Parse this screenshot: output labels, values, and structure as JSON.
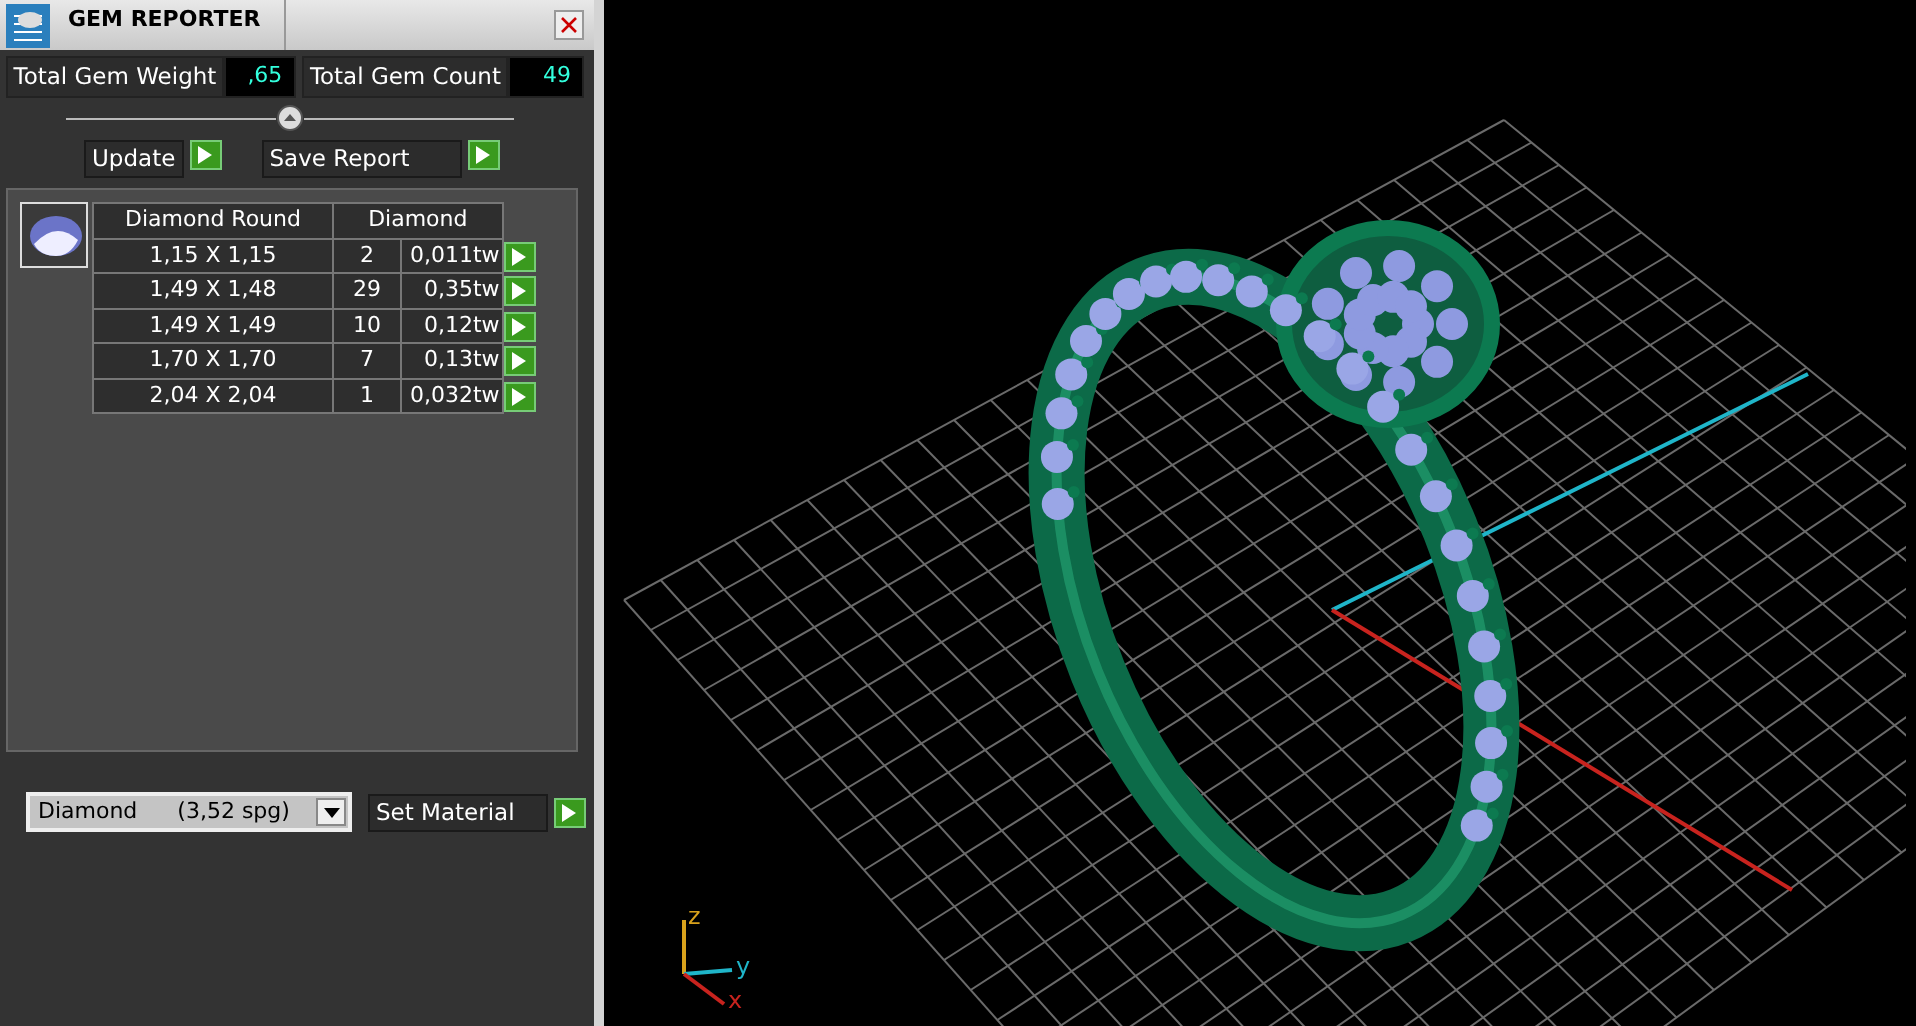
{
  "panel": {
    "title": "GEM REPORTER",
    "totals": [
      {
        "label": "Total Gem Weight",
        "value": ",65"
      },
      {
        "label": "Total Gem Count",
        "value": "49"
      }
    ],
    "buttons": [
      {
        "label": "Update"
      },
      {
        "label": "Save Report"
      }
    ]
  },
  "table": {
    "columns": [
      "Diamond Round",
      "Diamond"
    ],
    "rows": [
      {
        "size": "1,15 X 1,15",
        "count": "2",
        "weight": "0,011tw"
      },
      {
        "size": "1,49 X 1,48",
        "count": "29",
        "weight": "0,35tw"
      },
      {
        "size": "1,49 X 1,49",
        "count": "10",
        "weight": "0,12tw"
      },
      {
        "size": "1,70 X 1,70",
        "count": "7",
        "weight": "0,13tw"
      },
      {
        "size": "2,04 X 2,04",
        "count": "1",
        "weight": "0,032tw"
      }
    ]
  },
  "material": {
    "name": "Diamond",
    "density": "(3,52 spg)",
    "button": "Set Material"
  },
  "viewport": {
    "axes": [
      {
        "label": "z",
        "color": "#d9a21c"
      },
      {
        "label": "y",
        "color": "#1fb5c9"
      },
      {
        "label": "x",
        "color": "#c8231e"
      }
    ]
  }
}
